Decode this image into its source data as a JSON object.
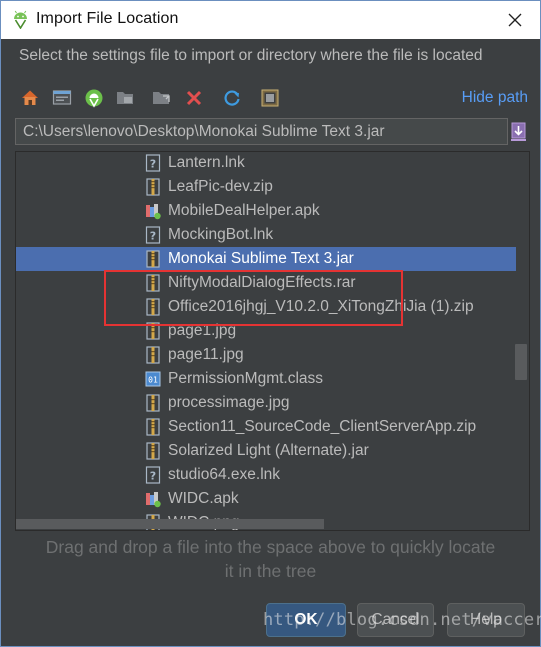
{
  "window": {
    "title": "Import File Location",
    "title_icon": "android-studio-icon",
    "close_icon": "close-icon"
  },
  "dialog": {
    "description": "Select the settings file to import or directory where the file is located",
    "hide_path_label": "Hide path",
    "path_value": "C:\\Users\\lenovo\\Desktop\\Monokai Sublime Text 3.jar",
    "hint_line1": "Drag and drop a file into the space above to quickly locate",
    "hint_line2": "it in the tree",
    "ok_label": "OK",
    "cancel_label": "Cancel",
    "help_label": "Help"
  },
  "toolbar": [
    {
      "icon": "home-icon"
    },
    {
      "icon": "desktop-icon"
    },
    {
      "icon": "android-project-icon"
    },
    {
      "icon": "module-folder-icon"
    },
    {
      "icon": "new-folder-icon"
    },
    {
      "icon": "delete-icon"
    },
    {
      "icon": "refresh-icon"
    },
    {
      "icon": "show-hidden-icon"
    }
  ],
  "files": [
    {
      "name": "Lantern.lnk",
      "icon": "unknown-file-icon"
    },
    {
      "name": "LeafPic-dev.zip",
      "icon": "archive-icon"
    },
    {
      "name": "MobileDealHelper.apk",
      "icon": "apk-icon"
    },
    {
      "name": "MockingBot.lnk",
      "icon": "unknown-file-icon"
    },
    {
      "name": "Monokai Sublime Text 3.jar",
      "icon": "archive-icon",
      "selected": true
    },
    {
      "name": "NiftyModalDialogEffects.rar",
      "icon": "archive-icon"
    },
    {
      "name": "Office2016jhgj_V10.2.0_XiTongZhiJia (1).zip",
      "icon": "archive-icon"
    },
    {
      "name": "page1.jpg",
      "icon": "image-file-icon"
    },
    {
      "name": "page11.jpg",
      "icon": "image-file-icon"
    },
    {
      "name": "PermissionMgmt.class",
      "icon": "class-file-icon"
    },
    {
      "name": "processimage.jpg",
      "icon": "image-file-icon"
    },
    {
      "name": "Section11_SourceCode_ClientServerApp.zip",
      "icon": "archive-icon"
    },
    {
      "name": "Solarized Light (Alternate).jar",
      "icon": "archive-icon"
    },
    {
      "name": "studio64.exe.lnk",
      "icon": "unknown-file-icon"
    },
    {
      "name": "WIDC.apk",
      "icon": "apk-icon"
    },
    {
      "name": "WIDC.png",
      "icon": "image-file-icon"
    }
  ],
  "watermark": "http://blog.csdn.net/vaccer",
  "colors": {
    "selection": "#4b6eaf",
    "link": "#589df6",
    "highlight_box": "#e53333",
    "ok_button": "#365880"
  }
}
